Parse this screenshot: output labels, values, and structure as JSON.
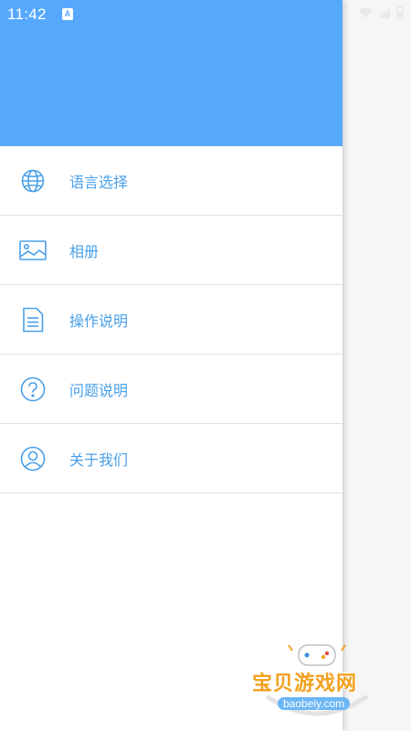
{
  "status_bar": {
    "time": "11:42",
    "notification_badge": "A"
  },
  "drawer": {
    "header_color": "#56a8fd",
    "items": [
      {
        "label": "语言选择",
        "icon": "globe-icon"
      },
      {
        "label": "相册",
        "icon": "image-icon"
      },
      {
        "label": "操作说明",
        "icon": "document-icon"
      },
      {
        "label": "问题说明",
        "icon": "question-circle-icon"
      },
      {
        "label": "关于我们",
        "icon": "user-circle-icon"
      }
    ]
  },
  "watermark": {
    "title": "宝贝游戏网",
    "subtitle": "baobeiy.com"
  },
  "colors": {
    "accent": "#4aa0e8",
    "header": "#56a8fd",
    "scrim": "#f6f6f6"
  }
}
